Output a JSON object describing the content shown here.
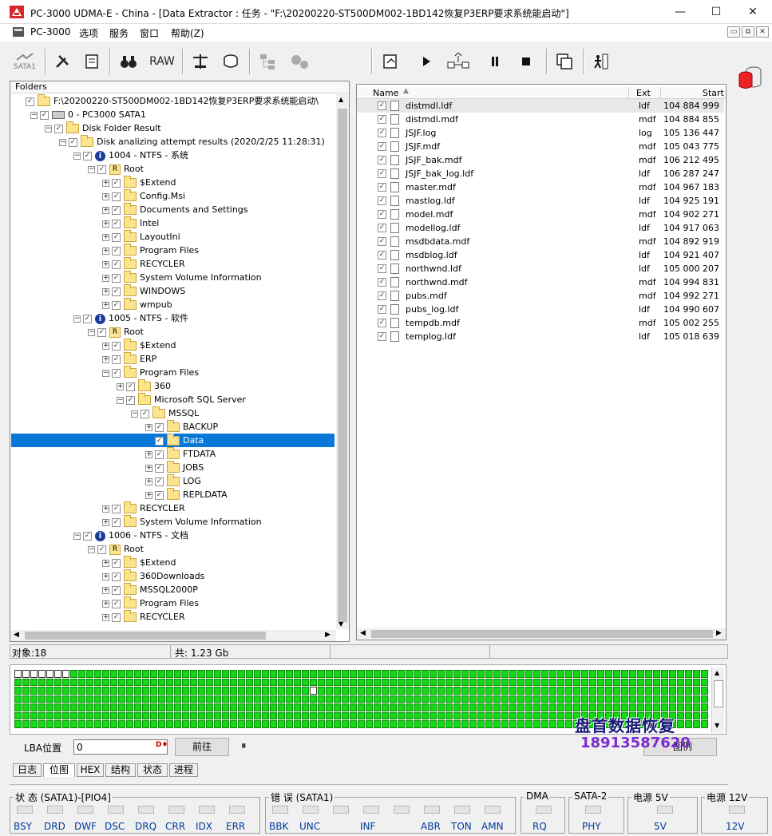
{
  "window": {
    "title": "PC-3000 UDMA-E - China - [Data Extractor : 任务 - \"F:\\20200220-ST500DM002-1BD142恢复P3ERP要求系统能启动\"]",
    "minimize": "—",
    "maximize": "☐",
    "close": "✕"
  },
  "menu": {
    "items": [
      "PC-3000",
      "选项",
      "服务",
      "窗口",
      "帮助(Z)"
    ],
    "mdi": [
      "▭",
      "⧉",
      "✕"
    ]
  },
  "toolbar": {
    "sata_label": "SATA1",
    "raw_label": "RAW"
  },
  "folders": {
    "header": "Folders",
    "rows": [
      {
        "label": "F:\\20200220-ST500DM002-1BD142恢复P3ERP要求系统能启动\\",
        "indent": 0,
        "icon": "root-disk",
        "exp": ""
      },
      {
        "label": "0 - PC3000 SATA1",
        "indent": 1,
        "icon": "hdd",
        "exp": "−"
      },
      {
        "label": "Disk Folder Result",
        "indent": 2,
        "icon": "folder",
        "exp": "−"
      },
      {
        "label": "Disk analizing attempt results (2020/2/25 11:28:31)",
        "indent": 3,
        "icon": "folder",
        "exp": "−"
      },
      {
        "label": "1004 - NTFS - 系统",
        "indent": 4,
        "icon": "info",
        "exp": "−"
      },
      {
        "label": "Root",
        "indent": 5,
        "icon": "rootico",
        "exp": "−"
      },
      {
        "label": "$Extend",
        "indent": 6,
        "icon": "folder",
        "exp": "+"
      },
      {
        "label": "Config.Msi",
        "indent": 6,
        "icon": "folder",
        "exp": "+"
      },
      {
        "label": "Documents and Settings",
        "indent": 6,
        "icon": "folder",
        "exp": "+"
      },
      {
        "label": "Intel",
        "indent": 6,
        "icon": "folder",
        "exp": "+"
      },
      {
        "label": "LayoutIni",
        "indent": 6,
        "icon": "folder",
        "exp": "+"
      },
      {
        "label": "Program Files",
        "indent": 6,
        "icon": "folder",
        "exp": "+"
      },
      {
        "label": "RECYCLER",
        "indent": 6,
        "icon": "folder",
        "exp": "+"
      },
      {
        "label": "System Volume Information",
        "indent": 6,
        "icon": "folder",
        "exp": "+"
      },
      {
        "label": "WINDOWS",
        "indent": 6,
        "icon": "folder",
        "exp": "+"
      },
      {
        "label": "wmpub",
        "indent": 6,
        "icon": "folder",
        "exp": "+"
      },
      {
        "label": "1005 - NTFS - 软件",
        "indent": 4,
        "icon": "info",
        "exp": "−"
      },
      {
        "label": "Root",
        "indent": 5,
        "icon": "rootico",
        "exp": "−"
      },
      {
        "label": "$Extend",
        "indent": 6,
        "icon": "folder",
        "exp": "+"
      },
      {
        "label": "ERP",
        "indent": 6,
        "icon": "folder",
        "exp": "+"
      },
      {
        "label": "Program Files",
        "indent": 6,
        "icon": "folder",
        "exp": "−"
      },
      {
        "label": "360",
        "indent": 7,
        "icon": "folder",
        "exp": "+"
      },
      {
        "label": "Microsoft SQL Server",
        "indent": 7,
        "icon": "folder",
        "exp": "−"
      },
      {
        "label": "MSSQL",
        "indent": 8,
        "icon": "folder",
        "exp": "−"
      },
      {
        "label": "BACKUP",
        "indent": 9,
        "icon": "folder",
        "exp": "+"
      },
      {
        "label": "Data",
        "indent": 9,
        "icon": "folder",
        "exp": "",
        "selected": true
      },
      {
        "label": "FTDATA",
        "indent": 9,
        "icon": "folder",
        "exp": "+"
      },
      {
        "label": "JOBS",
        "indent": 9,
        "icon": "folder",
        "exp": "+"
      },
      {
        "label": "LOG",
        "indent": 9,
        "icon": "folder",
        "exp": "+"
      },
      {
        "label": "REPLDATA",
        "indent": 9,
        "icon": "folder",
        "exp": "+"
      },
      {
        "label": "RECYCLER",
        "indent": 6,
        "icon": "folder",
        "exp": "+"
      },
      {
        "label": "System Volume Information",
        "indent": 6,
        "icon": "folder",
        "exp": "+"
      },
      {
        "label": "1006 - NTFS - 文档",
        "indent": 4,
        "icon": "info",
        "exp": "−"
      },
      {
        "label": "Root",
        "indent": 5,
        "icon": "rootico",
        "exp": "−"
      },
      {
        "label": "$Extend",
        "indent": 6,
        "icon": "folder",
        "exp": "+"
      },
      {
        "label": "360Downloads",
        "indent": 6,
        "icon": "folder",
        "exp": "+"
      },
      {
        "label": "MSSQL2000P",
        "indent": 6,
        "icon": "folder",
        "exp": "+"
      },
      {
        "label": "Program Files",
        "indent": 6,
        "icon": "folder",
        "exp": "+"
      },
      {
        "label": "RECYCLER",
        "indent": 6,
        "icon": "folder",
        "exp": "+"
      }
    ]
  },
  "files": {
    "columns": [
      "Name",
      "Ext",
      "Start"
    ],
    "rows": [
      [
        "distmdl.ldf",
        "ldf",
        "104 884 999"
      ],
      [
        "distmdl.mdf",
        "mdf",
        "104 884 855"
      ],
      [
        "JSJF.log",
        "log",
        "105 136 447"
      ],
      [
        "JSJF.mdf",
        "mdf",
        "105 043 775"
      ],
      [
        "JSJF_bak.mdf",
        "mdf",
        "106 212 495"
      ],
      [
        "JSJF_bak_log.ldf",
        "ldf",
        "106 287 247"
      ],
      [
        "master.mdf",
        "mdf",
        "104 967 183"
      ],
      [
        "mastlog.ldf",
        "ldf",
        "104 925 191"
      ],
      [
        "model.mdf",
        "mdf",
        "104 902 271"
      ],
      [
        "modellog.ldf",
        "ldf",
        "104 917 063"
      ],
      [
        "msdbdata.mdf",
        "mdf",
        "104 892 919"
      ],
      [
        "msdblog.ldf",
        "ldf",
        "104 921 407"
      ],
      [
        "northwnd.ldf",
        "ldf",
        "105 000 207"
      ],
      [
        "northwnd.mdf",
        "mdf",
        "104 994 831"
      ],
      [
        "pubs.mdf",
        "mdf",
        "104 992 271"
      ],
      [
        "pubs_log.ldf",
        "ldf",
        "104 990 607"
      ],
      [
        "tempdb.mdf",
        "mdf",
        "105 002 255"
      ],
      [
        "templog.ldf",
        "ldf",
        "105 018 639"
      ]
    ]
  },
  "status": {
    "objects": "对象:18",
    "total": "共: 1.23 Gb"
  },
  "lba": {
    "label": "LBA位置",
    "value": "0",
    "go": "前往",
    "pause": "⏸",
    "legend": "图例"
  },
  "watermark": {
    "line1": "盘首数据恢复",
    "line2": "18913587620"
  },
  "tabs": [
    "日志",
    "位图",
    "HEX",
    "结构",
    "状态",
    "进程"
  ],
  "groups": {
    "state": {
      "title": "状 态 (SATA1)-[PIO4]",
      "leds": [
        "BSY",
        "DRD",
        "DWF",
        "DSC",
        "DRQ",
        "CRR",
        "IDX",
        "ERR"
      ]
    },
    "error": {
      "title": "错 误 (SATA1)",
      "leds": [
        "BBK",
        "UNC",
        "",
        "INF",
        "",
        "ABR",
        "TON",
        "AMN"
      ]
    },
    "dma": {
      "title": "DMA",
      "leds": [
        "RQ"
      ]
    },
    "sata2": {
      "title": "SATA-2",
      "leds": [
        "PHY"
      ]
    },
    "pow5": {
      "title": "电源 5V",
      "leds": [
        "5V"
      ]
    },
    "pow12": {
      "title": "电源 12V",
      "leds": [
        "12V"
      ]
    }
  },
  "colors": {
    "selection": "#0a78d7",
    "bitmap_green": "#15d915",
    "led_label": "#003a9b"
  }
}
